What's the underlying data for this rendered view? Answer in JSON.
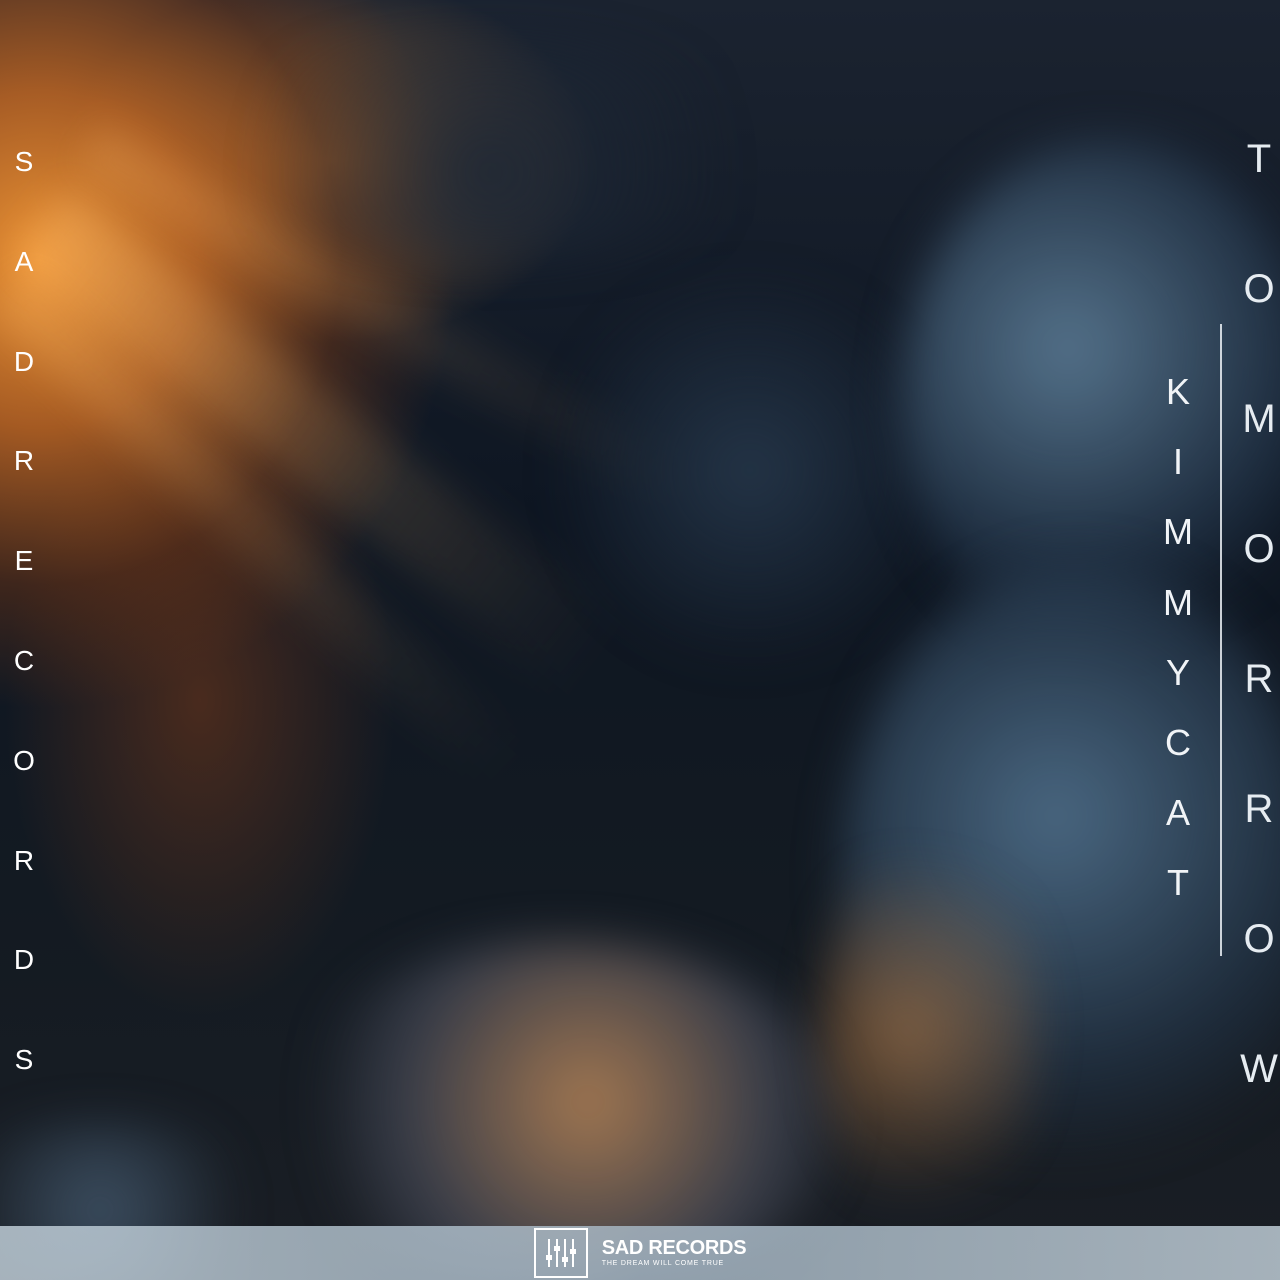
{
  "cover": {
    "label_left": [
      "S",
      "A",
      "D",
      "R",
      "E",
      "C",
      "O",
      "R",
      "D",
      "S"
    ],
    "artist": [
      "K",
      "I",
      "M",
      "M",
      "Y",
      "C",
      "A",
      "T"
    ],
    "title": [
      "T",
      "O",
      "M",
      "O",
      "R",
      "R",
      "O",
      "W"
    ]
  },
  "brand": {
    "name": "SAD RECORDS",
    "tagline": "THE DREAM WILL COME TRUE",
    "icon": "mixer-sliders-icon"
  },
  "colors": {
    "text": "#ffffff",
    "brand_bar": "#b9c9d5",
    "sun": "#f69834",
    "cloud_blue": "#4f6f8c"
  }
}
